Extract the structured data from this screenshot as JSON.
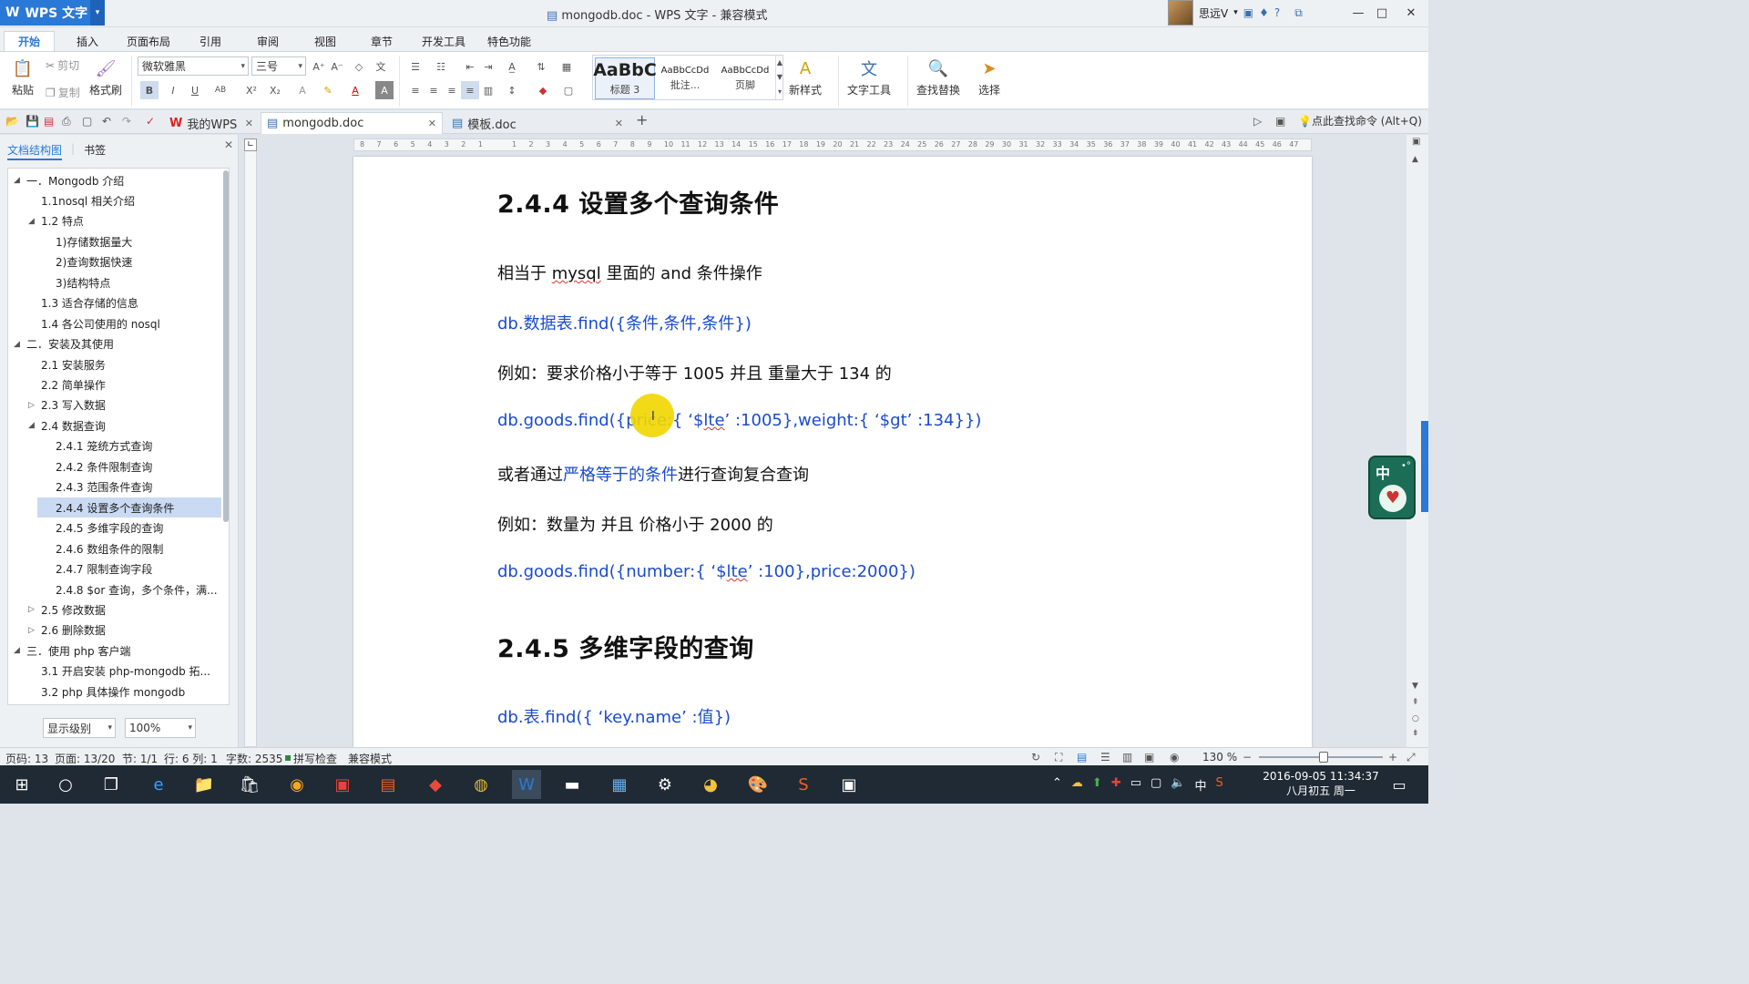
{
  "titlebar": {
    "app_name": "WPS 文字",
    "window_title": "mongodb.doc - WPS 文字 - 兼容模式",
    "user_name": "思远V"
  },
  "menu": [
    "开始",
    "插入",
    "页面布局",
    "引用",
    "审阅",
    "视图",
    "章节",
    "开发工具",
    "特色功能"
  ],
  "ribbon": {
    "paste": "粘贴",
    "cut": "剪切",
    "copy": "复制",
    "format_painter": "格式刷",
    "font_name": "微软雅黑",
    "font_size": "三号",
    "styles": [
      {
        "preview": "AaBbC",
        "label": "标题 3"
      },
      {
        "preview": "AaBbCcDd",
        "label": "批注..."
      },
      {
        "preview": "AaBbCcDd",
        "label": "页脚"
      }
    ],
    "new_style": "新样式",
    "text_tools": "文字工具",
    "find_replace": "查找替换",
    "select": "选择"
  },
  "doc_tabs": [
    {
      "label": "我的WPS"
    },
    {
      "label": "mongodb.doc"
    },
    {
      "label": "模板.doc"
    }
  ],
  "find_command": "点此查找命令 (Alt+Q)",
  "left_panel": {
    "tab_outline": "文档结构图",
    "tab_bookmark": "书签",
    "tree": [
      {
        "label": "一．Mongodb 介绍",
        "level": 0,
        "toggle": "◢"
      },
      {
        "label": "1.1nosql 相关介绍",
        "level": 1,
        "toggle": ""
      },
      {
        "label": "1.2 特点",
        "level": 1,
        "toggle": "◢"
      },
      {
        "label": "1)存储数据量大",
        "level": 2,
        "toggle": ""
      },
      {
        "label": "2)查询数据快速",
        "level": 2,
        "toggle": ""
      },
      {
        "label": "3)结构特点",
        "level": 2,
        "toggle": ""
      },
      {
        "label": "1.3 适合存储的信息",
        "level": 1,
        "toggle": ""
      },
      {
        "label": "1.4 各公司使用的 nosql",
        "level": 1,
        "toggle": ""
      },
      {
        "label": "二．安装及其使用",
        "level": 0,
        "toggle": "◢"
      },
      {
        "label": "2.1 安装服务",
        "level": 1,
        "toggle": ""
      },
      {
        "label": "2.2 简单操作",
        "level": 1,
        "toggle": ""
      },
      {
        "label": "2.3 写入数据",
        "level": 1,
        "toggle": "▷"
      },
      {
        "label": "2.4 数据查询",
        "level": 1,
        "toggle": "◢"
      },
      {
        "label": "2.4.1 笼统方式查询",
        "level": 2,
        "toggle": ""
      },
      {
        "label": "2.4.2 条件限制查询",
        "level": 2,
        "toggle": ""
      },
      {
        "label": "2.4.3 范围条件查询",
        "level": 2,
        "toggle": ""
      },
      {
        "label": "2.4.4 设置多个查询条件",
        "level": 2,
        "toggle": "",
        "selected": true
      },
      {
        "label": "2.4.5 多维字段的查询",
        "level": 2,
        "toggle": ""
      },
      {
        "label": "2.4.6 数组条件的限制",
        "level": 2,
        "toggle": ""
      },
      {
        "label": "2.4.7 限制查询字段",
        "level": 2,
        "toggle": ""
      },
      {
        "label": "2.4.8 $or 查询，多个条件，满...",
        "level": 2,
        "toggle": ""
      },
      {
        "label": "2.5 修改数据",
        "level": 1,
        "toggle": "▷"
      },
      {
        "label": "2.6 删除数据",
        "level": 1,
        "toggle": "▷"
      },
      {
        "label": "三．使用 php 客户端",
        "level": 0,
        "toggle": "◢"
      },
      {
        "label": "3.1 开启安装 php-mongodb 拓...",
        "level": 1,
        "toggle": ""
      },
      {
        "label": "3.2 php 具体操作 mongodb",
        "level": 1,
        "toggle": ""
      }
    ],
    "level_button": "显示级别",
    "zoom_value": "100%"
  },
  "document": {
    "heading1": "2.4.4 设置多个查询条件",
    "p1": {
      "pre": "相当于 ",
      "mid": "mysql",
      "post": " 里面的 and 条件操作"
    },
    "code1": "db.数据表.find({条件,条件,条件})",
    "p2": "例如：要求价格小于等于 1005 并且  重量大于 134 的",
    "code2": {
      "pre": "db.goods.find({price:{  ‘$",
      "mid": "lte",
      "post": "’ :1005},weight:{  ‘$gt’ :134}})"
    },
    "p3": {
      "pre": "或者通过",
      "link": "严格等于的条件",
      "post": "进行查询复合查询"
    },
    "p4": "例如：数量为    并且    价格小于 2000 的",
    "code3": {
      "pre": "db.goods.find({number:{  ‘$",
      "mid": "lte",
      "post": "’ :100},price:2000})"
    },
    "heading2": "2.4.5 多维字段的查询",
    "code4": "db.表.find({  ‘key.name’ :值})"
  },
  "ruler_numbers": [
    "8",
    "7",
    "6",
    "5",
    "4",
    "3",
    "2",
    "1",
    "",
    "1",
    "2",
    "3",
    "4",
    "5",
    "6",
    "7",
    "8",
    "9",
    "10",
    "11",
    "12",
    "13",
    "14",
    "15",
    "16",
    "17",
    "18",
    "19",
    "20",
    "21",
    "22",
    "23",
    "24",
    "25",
    "26",
    "27",
    "28",
    "29",
    "30",
    "31",
    "32",
    "33",
    "34",
    "35",
    "36",
    "37",
    "38",
    "39",
    "40",
    "41",
    "42",
    "43",
    "44",
    "45",
    "46",
    "47"
  ],
  "status": {
    "page_code": "页码: 13",
    "page": "页面: 13/20",
    "section": "节: 1/1",
    "row_col": "行: 6  列: 1",
    "word_count": "字数: 2535",
    "spell_check": "拼写检查",
    "compat_mode": "兼容模式",
    "zoom": "130 %"
  },
  "ime": {
    "label": "中"
  },
  "taskbar": {
    "time": "2016-09-05  11:34:37",
    "date": "八月初五 周一",
    "ime": "中"
  },
  "colors": {
    "accent": "#2b79d6",
    "code_blue": "#1a4bcf",
    "taskbar": "#1f2a35",
    "highlight": "#f2d600"
  }
}
